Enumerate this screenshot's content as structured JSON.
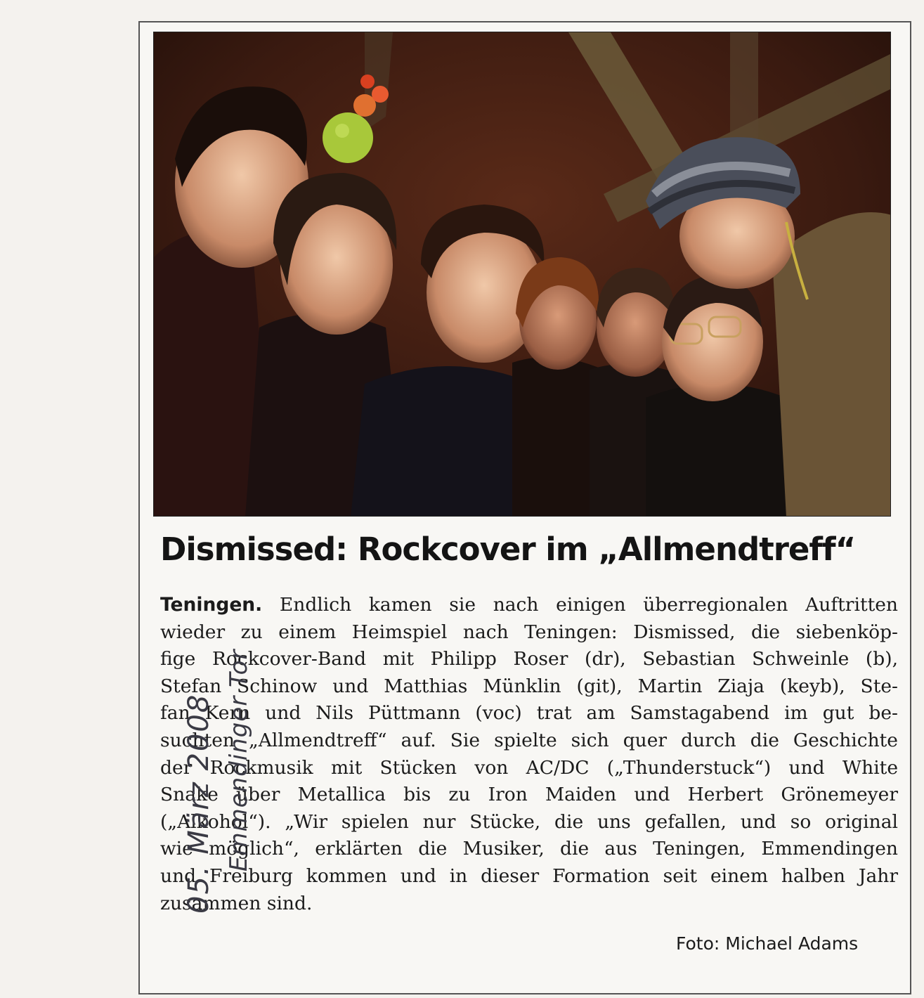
{
  "article": {
    "headline": "Dismissed: Rockcover im „Allmendtreff“",
    "lead": "Teningen.",
    "lines": [
      " Endlich kamen sie nach einigen überregionalen Auftritten",
      "wieder zu einem Heimspiel nach Teningen: Dismissed, die siebenköp-",
      "fige Rockcover-Band mit Philipp Roser (dr), Sebastian Schweinle (b),",
      "Stefan Schinow und Matthias Münklin (git), Martin Ziaja (keyb), Ste-",
      "fan Kern und Nils Püttmann (voc) trat am Samstagabend im gut be-",
      "suchten „Allmendtreff“ auf. Sie spielte sich quer durch die Geschichte",
      "der Rockmusik mit Stücken von AC/DC („Thunderstuck“) und White",
      "Snake über Metallica bis zu Iron Maiden und Herbert Grönemeyer",
      "(„Alkohol“). „Wir spielen nur Stücke, die uns gefallen, und so original",
      "wie möglich“, erklärten die Musiker, die aus Teningen, Emmendingen",
      "und Freiburg kommen und in dieser Formation seit einem halben Jahr",
      "zusammen sind."
    ],
    "photo_credit": "Foto: Michael Adams"
  },
  "handwritten_note": {
    "date": "05. März 2008",
    "source": "Emmendinger Tor"
  },
  "photo": {
    "description_icon": "band-photo",
    "colors": {
      "background": "#3a1f14",
      "beams": "#6b5a3a"
    }
  }
}
